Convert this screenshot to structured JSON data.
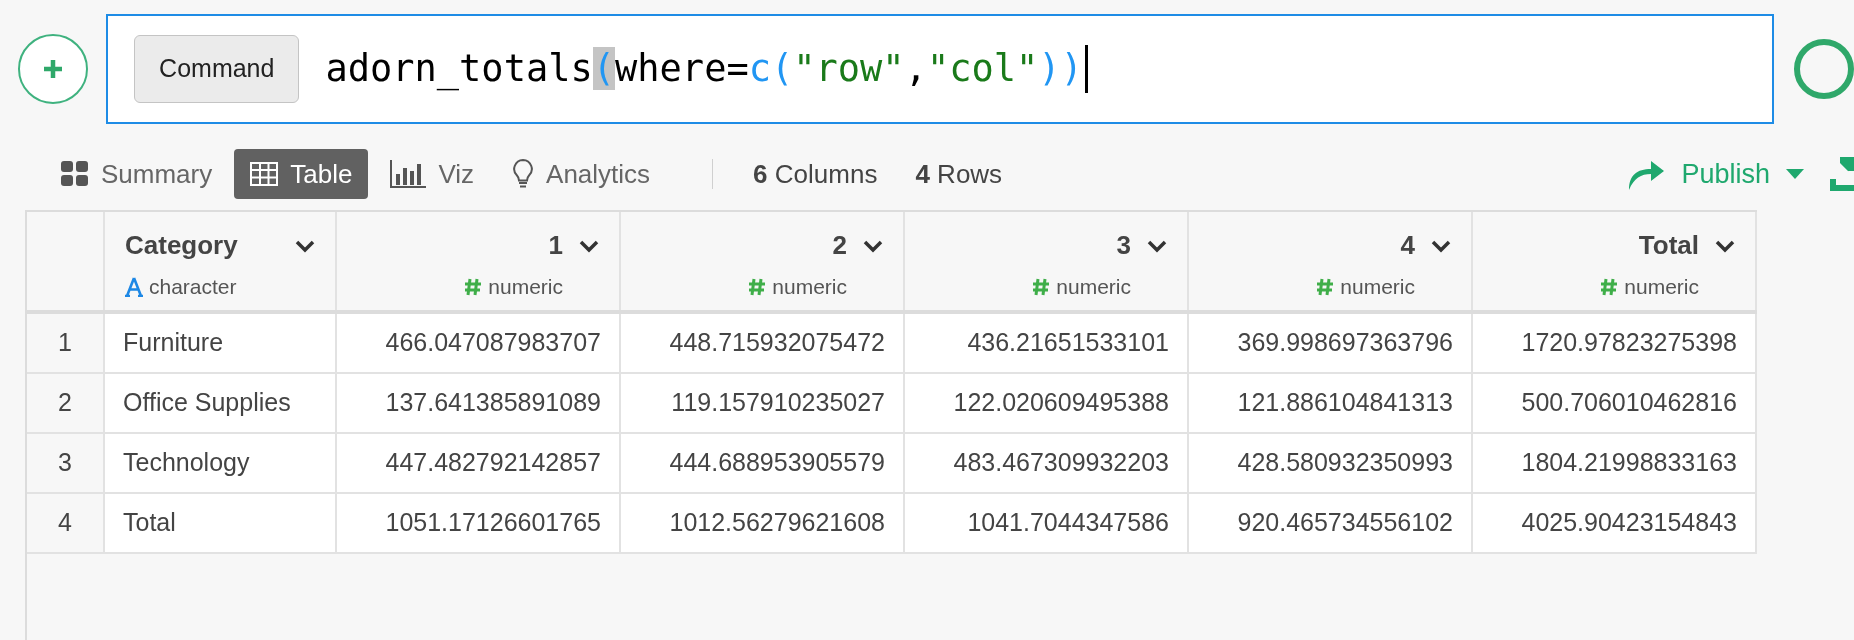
{
  "command": {
    "label": "Command",
    "tokens": [
      {
        "text": "adorn_totals",
        "kind": "plain",
        "highlighted": false
      },
      {
        "text": "(",
        "kind": "bracket",
        "highlighted": true
      },
      {
        "text": "where=",
        "kind": "plain",
        "highlighted": false
      },
      {
        "text": "c(",
        "kind": "bracket",
        "highlighted": false
      },
      {
        "text": "\"row\"",
        "kind": "string",
        "highlighted": false
      },
      {
        "text": ",",
        "kind": "plain",
        "highlighted": false
      },
      {
        "text": "\"col\"",
        "kind": "string",
        "highlighted": false
      },
      {
        "text": "))",
        "kind": "bracket",
        "highlighted": false
      }
    ]
  },
  "view_tabs": [
    {
      "label": "Summary",
      "kind": "summary",
      "selected": false
    },
    {
      "label": "Table",
      "kind": "table",
      "selected": true
    },
    {
      "label": "Viz",
      "kind": "viz",
      "selected": false
    },
    {
      "label": "Analytics",
      "kind": "analytics",
      "selected": false
    }
  ],
  "counts": [
    "**6** Columns",
    "**4** Rows"
  ],
  "publish": {
    "label": "Publish"
  },
  "table": {
    "columns": [
      {
        "name": "Category",
        "type": "character"
      },
      {
        "name": "1",
        "type": "numeric"
      },
      {
        "name": "2",
        "type": "numeric"
      },
      {
        "name": "3",
        "type": "numeric"
      },
      {
        "name": "4",
        "type": "numeric"
      },
      {
        "name": "Total",
        "type": "numeric"
      }
    ],
    "rows": [
      {
        "index": "1",
        "cells": [
          "Furniture",
          "466.047087983707",
          "448.715932075472",
          "436.21651533101",
          "369.998697363796",
          "1720.97823275398"
        ]
      },
      {
        "index": "2",
        "cells": [
          "Office Supplies",
          "137.641385891089",
          "119.157910235027",
          "122.020609495388",
          "121.886104841313",
          "500.706010462816"
        ]
      },
      {
        "index": "3",
        "cells": [
          "Technology",
          "447.482792142857",
          "444.688953905579",
          "483.467309932203",
          "428.580932350993",
          "1804.21998833163"
        ]
      },
      {
        "index": "4",
        "cells": [
          "Total",
          "1051.17126601765",
          "1012.56279621608",
          "1041.7044347586",
          "920.465734556102",
          "4025.90423154843"
        ]
      }
    ]
  }
}
